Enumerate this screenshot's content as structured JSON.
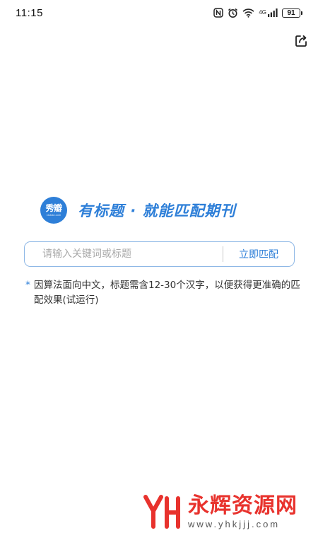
{
  "status_bar": {
    "time": "11:15",
    "network": "4G",
    "battery": "91",
    "icons": [
      "nfc-icon",
      "alarm-icon",
      "wifi-icon",
      "signal-icon",
      "battery-icon"
    ]
  },
  "header": {
    "share_icon": "share-icon"
  },
  "brand": {
    "logo_text": "秀瓣",
    "logo_sub": "xiuban.com",
    "slogan": "有标题 · 就能匹配期刊",
    "color": "#2e7fd8"
  },
  "search": {
    "placeholder": "请输入关键词或标题",
    "value": "",
    "button_label": "立即匹配"
  },
  "note": {
    "marker": "*",
    "text": "因算法面向中文，标题需含12-30个汉字，以便获得更准确的匹配效果(试运行)"
  },
  "watermark": {
    "title": "永辉资源网",
    "url": "www.yhkjjj.com",
    "color": "#e8322d"
  }
}
